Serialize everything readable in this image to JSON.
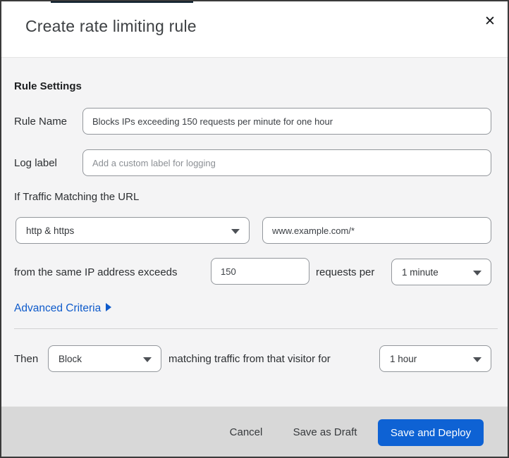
{
  "header": {
    "title": "Create rate limiting rule",
    "close": "✕"
  },
  "body": {
    "section_heading": "Rule Settings",
    "rule_name": {
      "label": "Rule Name",
      "value": "Blocks IPs exceeding 150 requests per minute for one hour"
    },
    "log_label": {
      "label": "Log label",
      "placeholder": "Add a custom label for logging"
    },
    "match": {
      "heading": "If Traffic Matching the URL",
      "scheme_value": "http & https",
      "url_value": "www.example.com/*"
    },
    "threshold": {
      "text_before": "from the same IP address exceeds",
      "count_value": "150",
      "text_after": "requests per",
      "period_value": "1 minute"
    },
    "advanced_link": "Advanced Criteria",
    "action": {
      "text_before": "Then",
      "action_value": "Block",
      "text_after": "matching traffic from that visitor for",
      "duration_value": "1 hour"
    }
  },
  "footer": {
    "cancel": "Cancel",
    "save_draft": "Save as Draft",
    "save_deploy": "Save and Deploy"
  },
  "colors": {
    "accent_blue": "#0e62d4",
    "link_blue": "#0f5bcb",
    "body_bg": "#f4f4f5",
    "footer_bg": "#d8d8d8",
    "top_strip": "#0a1d2c"
  }
}
